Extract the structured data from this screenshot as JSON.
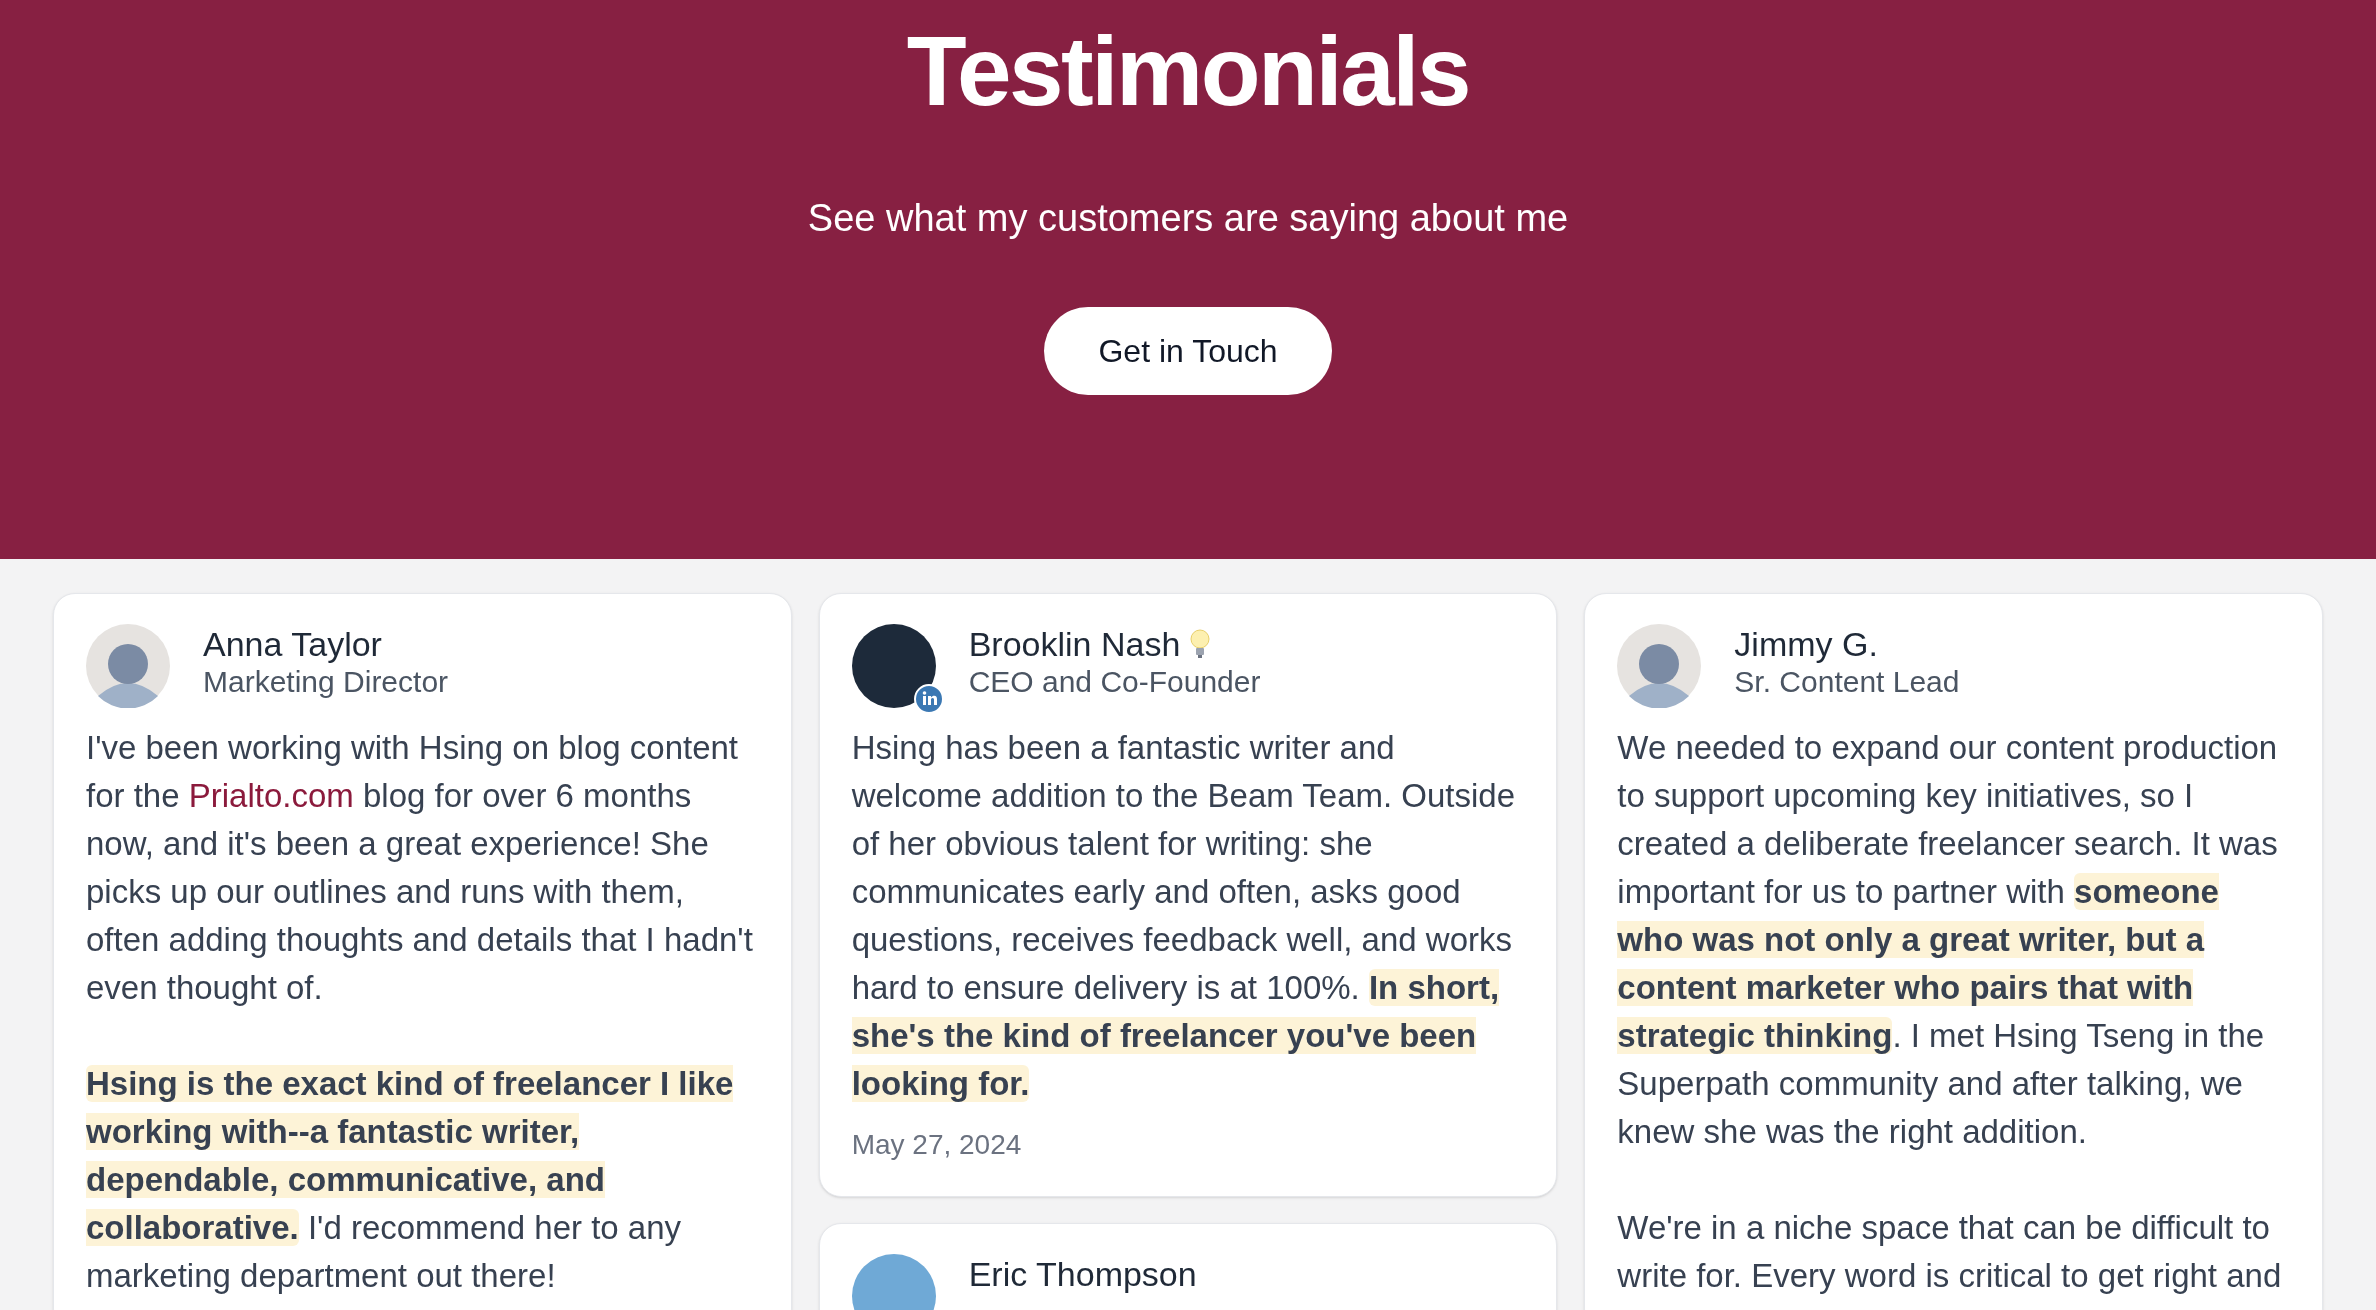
{
  "hero": {
    "title": "Testimonials",
    "subtitle": "See what my customers are saying about me",
    "button": "Get in Touch"
  },
  "columns": [
    [
      {
        "name": "Anna Taylor",
        "role": "Marketing Director",
        "paragraphs": [
          [
            {
              "kind": "text",
              "text": "I've been working with Hsing on blog content for the "
            },
            {
              "kind": "link",
              "text": "Prialto.com"
            },
            {
              "kind": "text",
              "text": " blog for over 6 months now, and it's been a great experience! She picks up our outlines and runs with them, often adding thoughts and details that I hadn't even thought of."
            }
          ],
          [
            {
              "kind": "text",
              "text": "**Hsing is the exact kind of freelancer I like working with--a fantastic writer, dependable, communicative, and collaborative.** I'd recommend her to any marketing department out there!"
            }
          ]
        ]
      }
    ],
    [
      {
        "name": "Brooklin Nash",
        "role": "CEO and Co-Founder",
        "photo": true,
        "linkedin": true,
        "name_badge": true,
        "paragraphs": [
          [
            {
              "kind": "text",
              "text": "Hsing has been a fantastic writer and welcome addition to the Beam Team. Outside of her obvious talent for writing: she communicates early and often, asks good questions, receives feedback well, and works hard to ensure delivery is at 100%. **In short, she's the kind of freelancer you've been looking for.**"
            }
          ]
        ],
        "date": "May 27, 2024"
      },
      {
        "name": "Eric Thompson",
        "photo": true
      }
    ],
    [
      {
        "name": "Jimmy G.",
        "role": "Sr. Content Lead",
        "paragraphs": [
          [
            {
              "kind": "text",
              "text": "We needed to expand our content production to support upcoming key initiatives, so I created a deliberate freelancer search. It was important for us to partner with **someone who was not only a great writer, but a content marketer who pairs that with strategic thinking**. I met Hsing Tseng in the Superpath community and after talking, we knew she was the right addition."
            }
          ],
          [
            {
              "kind": "text",
              "text": "We're in a niche space that can be difficult to write for. Every word is critical to get right and"
            }
          ]
        ]
      }
    ]
  ]
}
